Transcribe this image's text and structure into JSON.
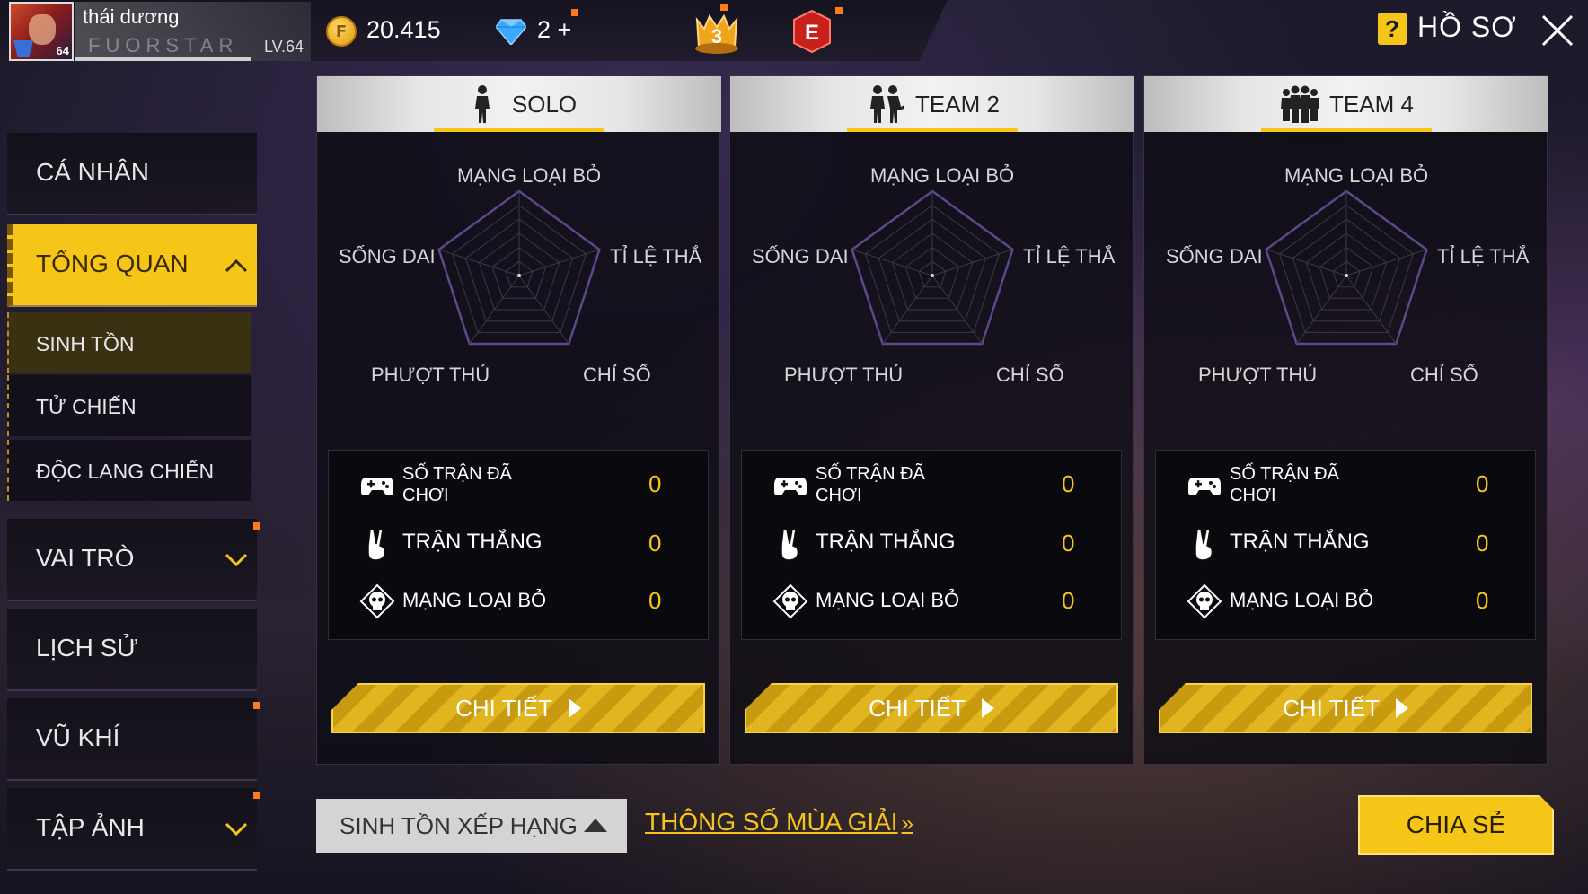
{
  "player": {
    "name": "thái dương",
    "guild": "FUORSTAR",
    "level_label": "LV.64",
    "avatar_level": "64"
  },
  "currency": {
    "coins": "20.415",
    "diamonds": "2 +"
  },
  "rank_badge": {
    "number": "3"
  },
  "e_badge": {
    "letter": "E"
  },
  "header": {
    "help_glyph": "?",
    "title": "HỒ SƠ"
  },
  "sidebar": {
    "items": [
      {
        "label": "CÁ NHÂN"
      },
      {
        "label": "TỔNG QUAN"
      },
      {
        "label": "VAI TRÒ"
      },
      {
        "label": "LỊCH SỬ"
      },
      {
        "label": "VŨ KHÍ"
      },
      {
        "label": "TẬP ẢNH"
      }
    ],
    "subitems": [
      {
        "label": "SINH TỒN"
      },
      {
        "label": "TỬ CHIẾN"
      },
      {
        "label": "ĐỘC LANG CHIẾN"
      }
    ]
  },
  "radar_labels": {
    "top": "MẠNG LOẠI BỎ",
    "left": "SỐNG DAI",
    "right": "TỈ LỆ THẮNG",
    "bottom_left": "PHƯỢT THỦ",
    "bottom_right": "CHỈ SỐ"
  },
  "stat_labels": {
    "matches": "SỐ TRẬN ĐÃ CHƠI",
    "wins": "TRẬN THẮNG",
    "kills": "MẠNG LOẠI BỎ"
  },
  "detail_label": "CHI TIẾT",
  "modes": [
    {
      "label": "SOLO",
      "matches": "0",
      "wins": "0",
      "kills": "0"
    },
    {
      "label": "TEAM 2",
      "matches": "0",
      "wins": "0",
      "kills": "0"
    },
    {
      "label": "TEAM 4",
      "matches": "0",
      "wins": "0",
      "kills": "0"
    }
  ],
  "bottom": {
    "mode_select": "SINH TỒN XẾP HẠNG",
    "season_link": "THÔNG SỐ MÙA GIẢI",
    "season_arrows": "»",
    "share": "CHIA SẺ"
  },
  "colors": {
    "accent": "#f5c518",
    "stat_value": "#f5c518",
    "notification_dot": "#ff7a1a"
  },
  "icons": {
    "coin": "gold-coin-icon",
    "diamond": "diamond-icon",
    "rank": "rank-badge-icon",
    "elite": "elite-pass-icon",
    "help": "help-icon",
    "close": "close-icon",
    "solo": "solo-soldier-icon",
    "team2": "duo-soldier-icon",
    "team4": "squad-soldier-icon",
    "matches": "gamepad-icon",
    "wins": "victory-hand-icon",
    "kills": "skull-icon"
  }
}
